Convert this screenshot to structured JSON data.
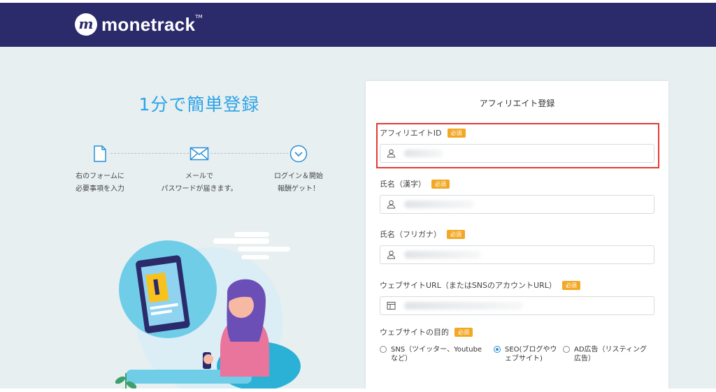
{
  "brand": {
    "logo_mark": "m",
    "name": "monetrack",
    "tm": "TM"
  },
  "hero": {
    "headline": "1分で簡単登録",
    "steps": [
      {
        "icon": "document-icon",
        "text": "右のフォームに\n必要事項を入力"
      },
      {
        "icon": "mail-icon",
        "text": "メールで\nパスワードが届きます。"
      },
      {
        "icon": "chevron-circle-icon",
        "text": "ログイン＆開始\n報酬ゲット！"
      }
    ]
  },
  "form": {
    "title": "アフィリエイト登録",
    "required_badge": "必須",
    "fields": [
      {
        "label": "アフィリエイトID",
        "icon": "user-icon"
      },
      {
        "label": "氏名（漢字）",
        "icon": "user-icon"
      },
      {
        "label": "氏名（フリガナ）",
        "icon": "user-icon"
      },
      {
        "label": "ウェブサイトURL（またはSNSのアカウントURL）",
        "icon": "layout-icon"
      }
    ],
    "purpose": {
      "label": "ウェブサイトの目的",
      "options": [
        {
          "label": "SNS（ツイッター、Youtube\nなど）",
          "selected": false
        },
        {
          "label": "SEO(ブログやウ\nェブサイト)",
          "selected": true
        },
        {
          "label": "AD広告（リスティング\n広告）",
          "selected": false
        }
      ]
    }
  },
  "colors": {
    "header": "#2b2a6b",
    "accent": "#2ba3e6",
    "badge": "#f3a825",
    "highlight": "#e53935"
  }
}
